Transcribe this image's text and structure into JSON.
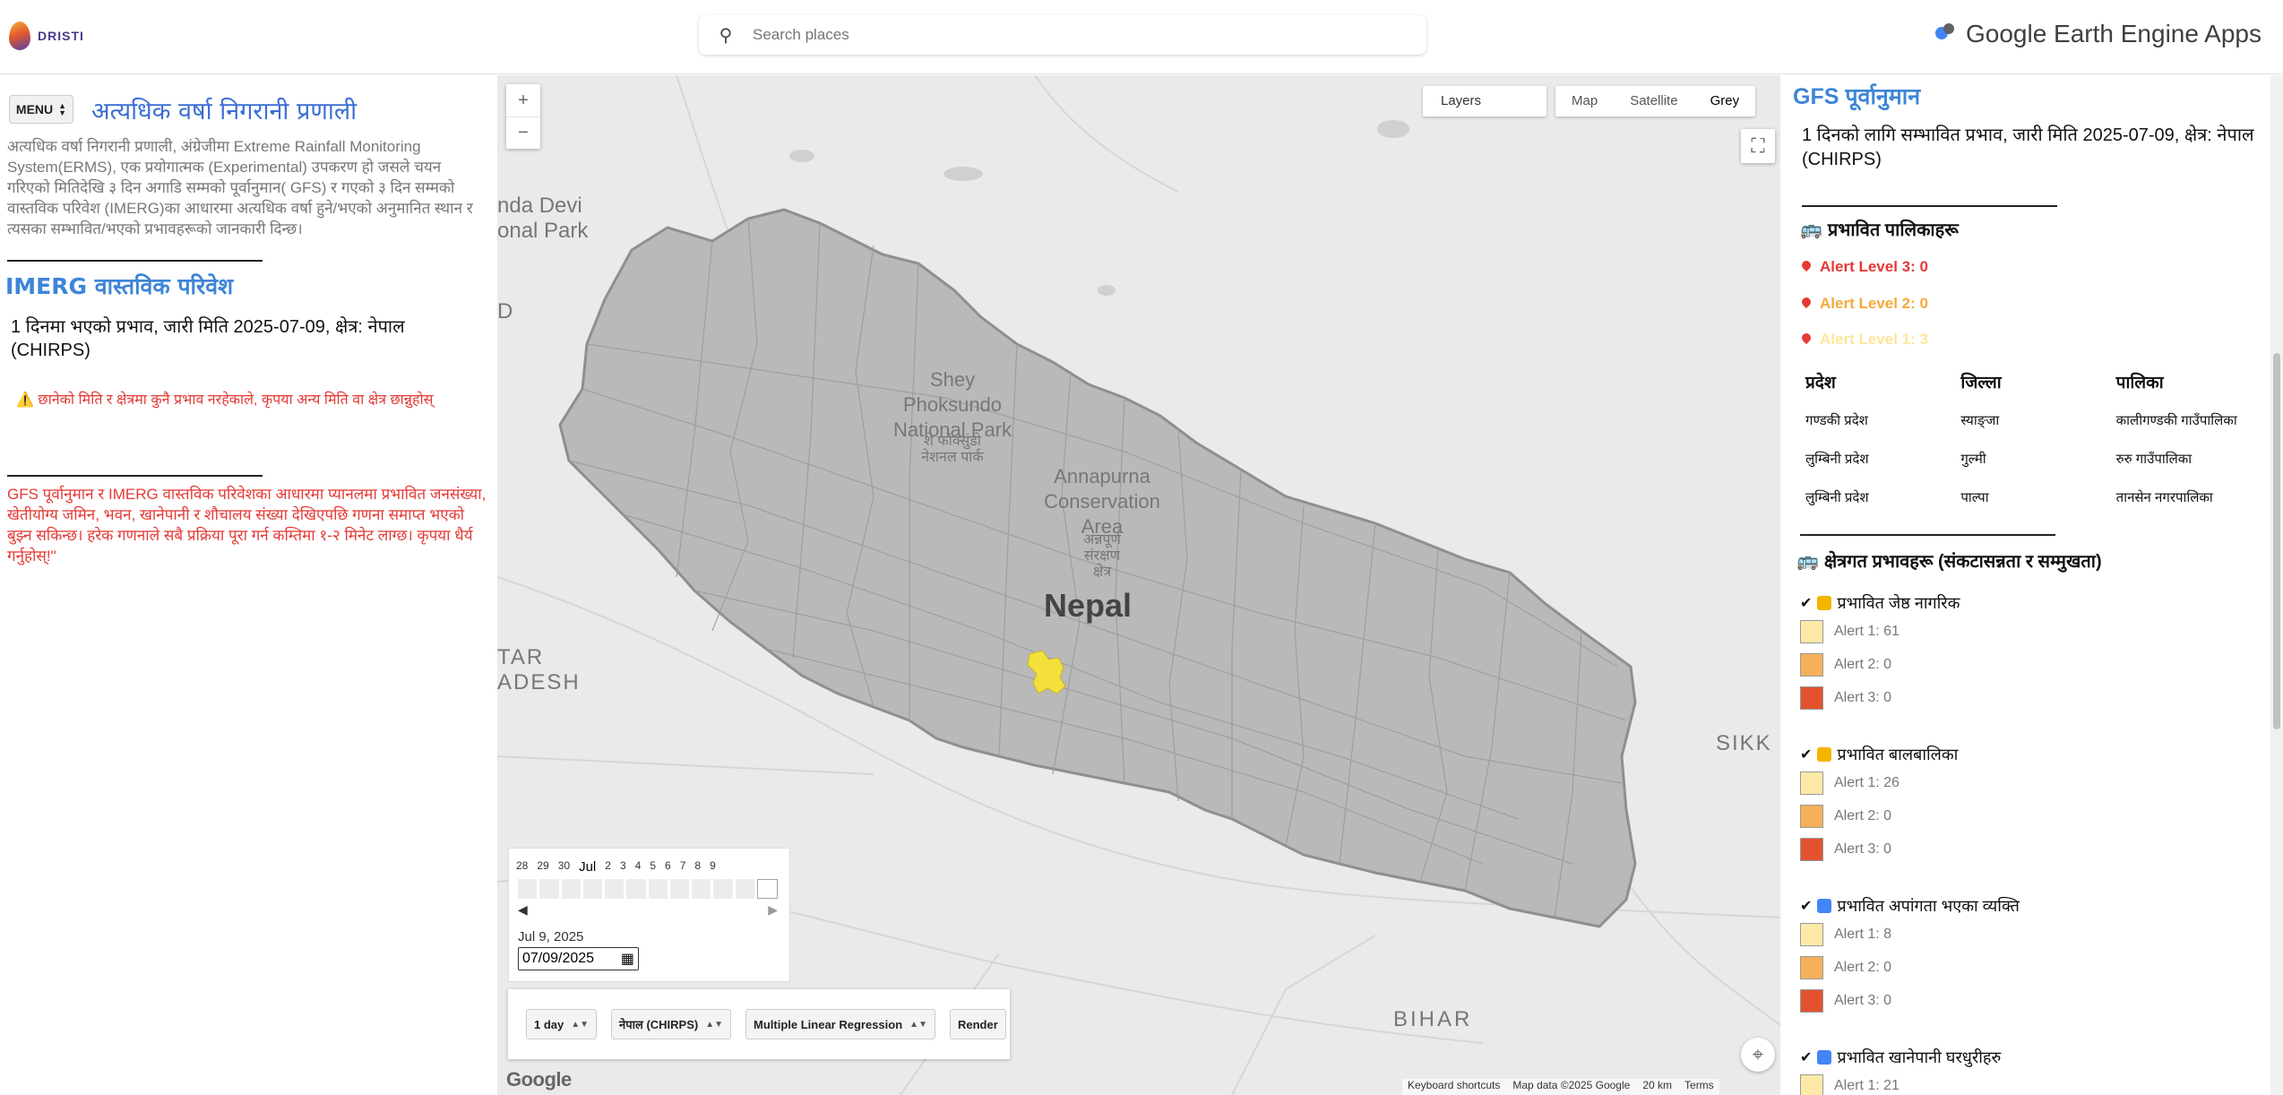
{
  "header": {
    "logo_text": "DRISTI",
    "search_placeholder": "Search places",
    "brand": "Google Earth Engine Apps"
  },
  "left_panel": {
    "menu_label": "MENU",
    "title": "अत्यधिक वर्षा निगरानी प्रणाली",
    "description": "अत्यधिक वर्षा निगरानी प्रणाली, अंग्रेजीमा Extreme Rainfall Monitoring System(ERMS), एक प्रयोगात्मक (Experimental) उपकरण हो जसले चयन गरिएको मितिदेखि ३ दिन अगाडि सम्मको पूर्वानुमान( GFS) र गएको ३ दिन सम्मको वास्तविक परिवेश (IMERG)का आधारमा अत्यधिक वर्षा हुने/भएको अनुमानित स्थान र त्यसका सम्भावित/भएको प्रभावहरूको जानकारी दिन्छ।",
    "imerg_heading": "IMERG वास्तविक परिवेश",
    "imerg_subtitle": "1 दिनमा भएको प्रभाव, जारी मिति 2025-07-09, क्षेत्र: नेपाल (CHIRPS)",
    "imerg_warning": "⚠️ छानेको मिति र क्षेत्रमा कुनै प्रभाव नरहेकाले, कृपया अन्य मिति वा क्षेत्र छान्नुहोस्",
    "note": "GFS पूर्वानुमान र IMERG वास्तविक परिवेशका आधारमा प्यानलमा प्रभावित जनसंख्या, खेतीयोग्य जमिन, भवन, खानेपानी र शौचालय संख्या देखिएपछि गणना समाप्त भएको बुझ्न सकिन्छ। हरेक गणनाले सबै प्रक्रिया पूरा गर्न कम्तिमा १-२ मिनेट लाग्छ। कृपया धैर्य गर्नुहोस्!\""
  },
  "map": {
    "zoom_in": "+",
    "zoom_out": "−",
    "layers_label": "Layers",
    "map_types": [
      "Map",
      "Satellite",
      "Grey"
    ],
    "active_map_type": "Grey",
    "labels": {
      "country": "Nepal",
      "shey": "Shey\nPhoksundo\nNational Park",
      "shey_np": "शे फोक्सुंडो\nनेशनल पार्क",
      "annapurna": "Annapurna\nConservation\nArea",
      "annapurna_np": "अन्नपूर्ण\nसंरक्षण\nक्षेत्र",
      "nanda": "nda Devi\nonal Park",
      "d_edge": "D",
      "tar": "TAR\nADESH",
      "bihar": "BIHAR",
      "sikk": "SIKK"
    },
    "timeline": {
      "days": [
        "28",
        "29",
        "30",
        "Jul",
        "2",
        "3",
        "4",
        "5",
        "6",
        "7",
        "8",
        "9"
      ],
      "prev": "◀",
      "next": "▶",
      "date_label": "Jul 9, 2025",
      "date_input": "07/09/2025"
    },
    "controls": {
      "period": "1 day",
      "region": "नेपाल (CHIRPS)",
      "model": "Multiple Linear Regression",
      "render": "Render"
    },
    "attribution": {
      "shortcuts": "Keyboard shortcuts",
      "map_data": "Map data ©2025 Google",
      "scale": "20 km",
      "terms": "Terms"
    },
    "google_logo": "Google"
  },
  "right_panel": {
    "gfs_heading": "GFS पूर्वानुमान",
    "gfs_subtitle": "1 दिनको लागि सम्भावित प्रभाव, जारी मिति 2025-07-09, क्षेत्र: नेपाल (CHIRPS)",
    "affected_munis_heading": "प्रभावित पालिकाहरू",
    "alert_levels": [
      {
        "label": "Alert Level 3: 0",
        "color": "#e53935"
      },
      {
        "label": "Alert Level 2: 0",
        "color": "#f4a93b"
      },
      {
        "label": "Alert Level 1: 3",
        "color": "#fde69a"
      }
    ],
    "table": {
      "headers": [
        "प्रदेश",
        "जिल्ला",
        "पालिका"
      ],
      "rows": [
        [
          "गण्डकी प्रदेश",
          "स्याङ्जा",
          "कालीगण्डकी गाउँपालिका"
        ],
        [
          "लुम्बिनी प्रदेश",
          "गुल्मी",
          "रुरु गाउँपालिका"
        ],
        [
          "लुम्बिनी प्रदेश",
          "पाल्पा",
          "तानसेन नगरपालिका"
        ]
      ]
    },
    "sector_heading": "क्षेत्रगत प्रभावहरू (संकटासन्नता र सम्मुखता)",
    "groups": [
      {
        "title": "प्रभावित जेष्ठ नागरिक",
        "alerts": [
          "Alert 1: 61",
          "Alert 2: 0",
          "Alert 3: 0"
        ]
      },
      {
        "title": "प्रभावित बालबालिका",
        "alerts": [
          "Alert 1: 26",
          "Alert 2: 0",
          "Alert 3: 0"
        ]
      },
      {
        "title": "प्रभावित अपांगता भएका व्यक्ति",
        "alerts": [
          "Alert 1: 8",
          "Alert 2: 0",
          "Alert 3: 0"
        ]
      },
      {
        "title": "प्रभावित खानेपानी घरधुरीहरु",
        "alerts": [
          "Alert 1: 21"
        ]
      }
    ],
    "legend_colors": [
      "#fde9a8",
      "#f4b15a",
      "#e2522f"
    ]
  }
}
